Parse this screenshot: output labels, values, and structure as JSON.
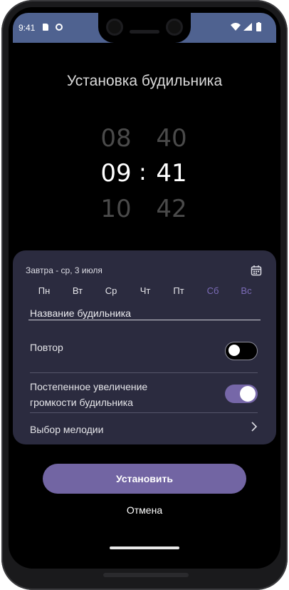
{
  "status_bar": {
    "time": "9:41",
    "background": "#4f6290"
  },
  "title": "Установка будильника",
  "time_picker": {
    "hours": {
      "prev": "08",
      "selected": "09",
      "next": "10"
    },
    "separator": ":",
    "minutes": {
      "prev": "40",
      "selected": "41",
      "next": "42"
    }
  },
  "card": {
    "date_label": "Завтра - ср, 3 июля",
    "calendar_icon": "calendar-icon",
    "days": [
      {
        "label": "Пн",
        "weekend": false
      },
      {
        "label": "Вт",
        "weekend": false
      },
      {
        "label": "Ср",
        "weekend": false
      },
      {
        "label": "Чт",
        "weekend": false
      },
      {
        "label": "Пт",
        "weekend": false
      },
      {
        "label": "Сб",
        "weekend": true
      },
      {
        "label": "Вс",
        "weekend": true
      }
    ],
    "name_placeholder": "Название будильника",
    "repeat": {
      "label": "Повтор",
      "enabled": false
    },
    "gradual_volume": {
      "label_line1": "Постепенное увеличение",
      "label_line2": "громкости будильника",
      "enabled": true
    },
    "melody": {
      "label": "Выбор мелодии"
    }
  },
  "actions": {
    "set_label": "Установить",
    "cancel_label": "Отмена"
  },
  "colors": {
    "accent": "#7265a3",
    "card": "#2b2b3f",
    "weekend": "#7c6cb8"
  }
}
